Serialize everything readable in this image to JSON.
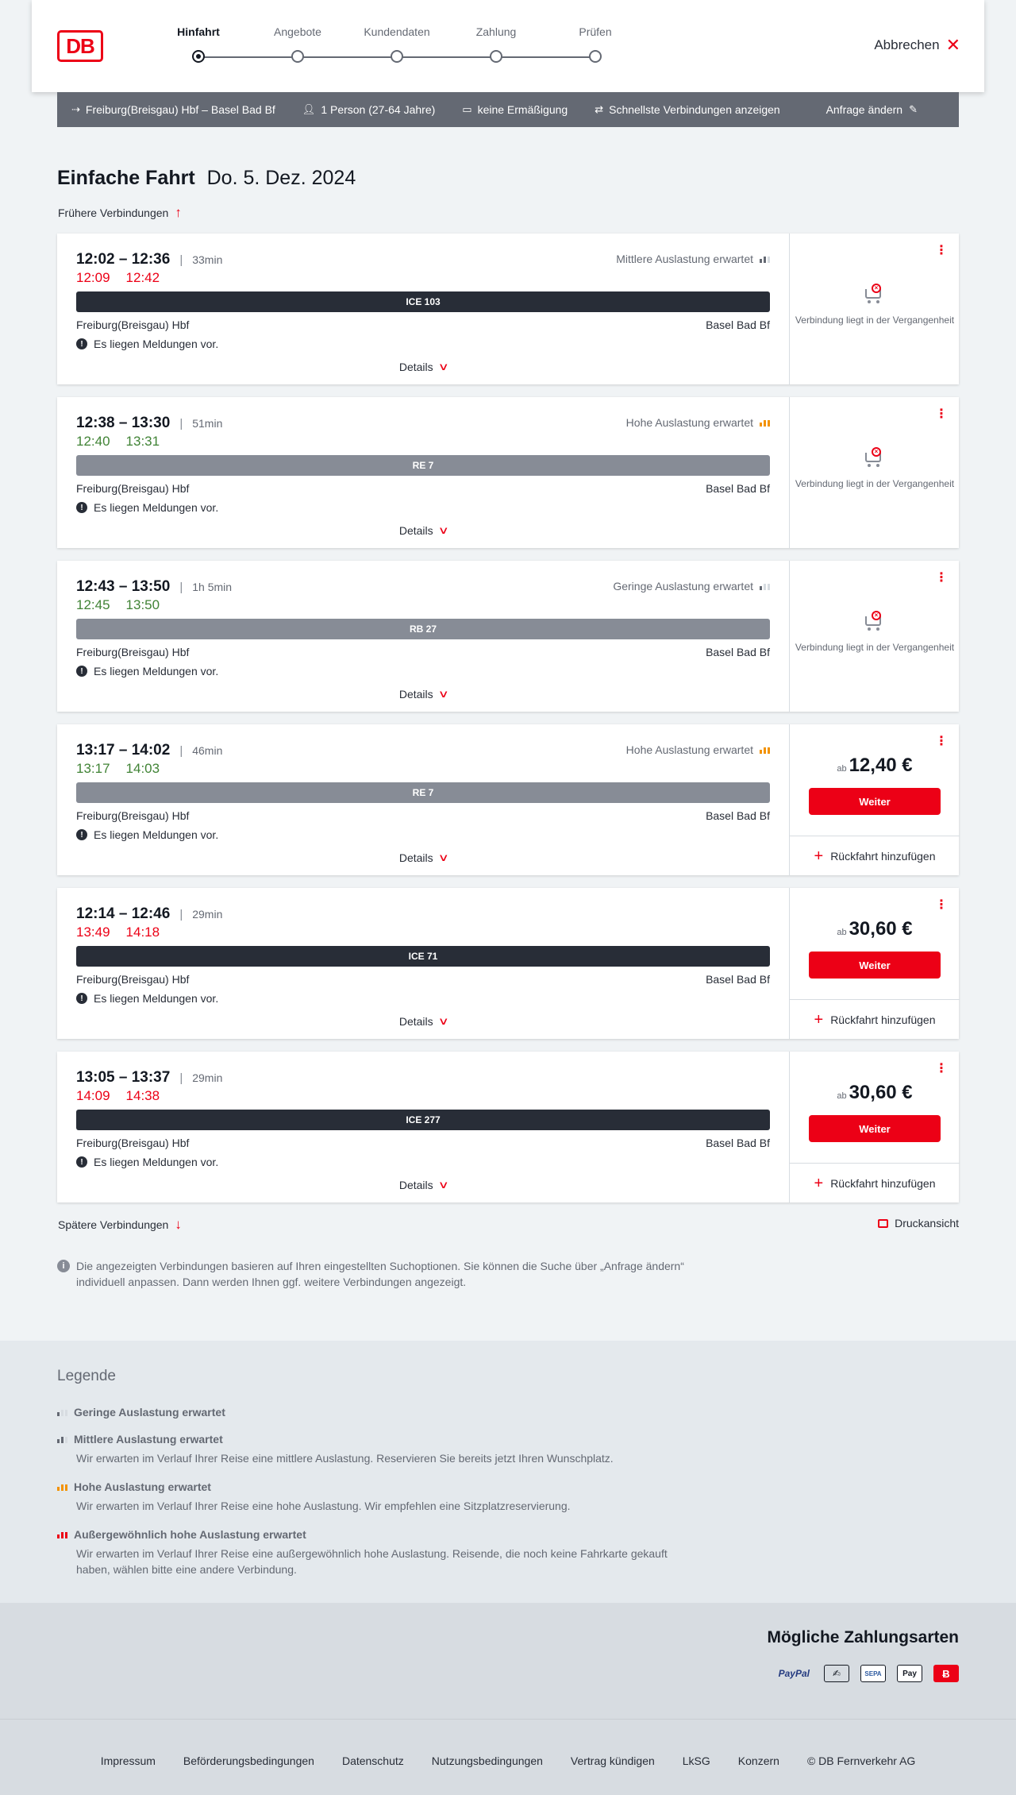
{
  "header": {
    "logo": "DB",
    "steps": [
      {
        "label": "Hinfahrt",
        "active": true
      },
      {
        "label": "Angebote",
        "active": false
      },
      {
        "label": "Kundendaten",
        "active": false
      },
      {
        "label": "Zahlung",
        "active": false
      },
      {
        "label": "Prüfen",
        "active": false
      }
    ],
    "cancel_label": "Abbrechen"
  },
  "searchbar": {
    "route": "Freiburg(Breisgau) Hbf – Basel Bad Bf",
    "passengers": "1 Person (27-64 Jahre)",
    "discount": "keine Ermäßigung",
    "filter": "Schnellste Verbindungen anzeigen",
    "change_label": "Anfrage ändern"
  },
  "title": {
    "type": "Einfache Fahrt",
    "date": "Do. 5. Dez. 2024"
  },
  "earlier_label": "Frühere Verbindungen",
  "later_label": "Spätere Verbindungen",
  "print_label": "Druckansicht",
  "details_label": "Details",
  "past_text": "Verbindung liegt in der Vergangenheit",
  "return_label": "Rückfahrt hinzufügen",
  "weiter_label": "Weiter",
  "price_prefix": "ab",
  "journeys": [
    {
      "time": "12:02 – 12:36",
      "duration": "33min",
      "load": "Mittlere Auslastung erwartet",
      "load_level": 2,
      "rt_dep": "12:09",
      "rt_arr": "12:42",
      "rt_status": "late",
      "train": "ICE 103",
      "train_style": "dark",
      "from": "Freiburg(Breisgau) Hbf",
      "to": "Basel Bad Bf",
      "message": "Es liegen Meldungen vor.",
      "past": true,
      "price": ""
    },
    {
      "time": "12:38 – 13:30",
      "duration": "51min",
      "load": "Hohe Auslastung erwartet",
      "load_level": 3,
      "rt_dep": "12:40",
      "rt_arr": "13:31",
      "rt_status": "ok",
      "train": "RE 7",
      "train_style": "grey",
      "from": "Freiburg(Breisgau) Hbf",
      "to": "Basel Bad Bf",
      "message": "Es liegen Meldungen vor.",
      "past": true,
      "price": ""
    },
    {
      "time": "12:43 – 13:50",
      "duration": "1h 5min",
      "load": "Geringe Auslastung erwartet",
      "load_level": 1,
      "rt_dep": "12:45",
      "rt_arr": "13:50",
      "rt_status": "ok",
      "train": "RB 27",
      "train_style": "grey",
      "from": "Freiburg(Breisgau) Hbf",
      "to": "Basel Bad Bf",
      "message": "Es liegen Meldungen vor.",
      "past": true,
      "price": ""
    },
    {
      "time": "13:17 – 14:02",
      "duration": "46min",
      "load": "Hohe Auslastung erwartet",
      "load_level": 3,
      "rt_dep": "13:17",
      "rt_arr": "14:03",
      "rt_status": "ok",
      "train": "RE 7",
      "train_style": "grey",
      "from": "Freiburg(Breisgau) Hbf",
      "to": "Basel Bad Bf",
      "message": "Es liegen Meldungen vor.",
      "past": false,
      "price": "12,40 €"
    },
    {
      "time": "12:14 – 12:46",
      "duration": "29min",
      "load": "",
      "load_level": 0,
      "rt_dep": "13:49",
      "rt_arr": "14:18",
      "rt_status": "late",
      "train": "ICE 71",
      "train_style": "dark",
      "from": "Freiburg(Breisgau) Hbf",
      "to": "Basel Bad Bf",
      "message": "Es liegen Meldungen vor.",
      "past": false,
      "price": "30,60 €"
    },
    {
      "time": "13:05 – 13:37",
      "duration": "29min",
      "load": "",
      "load_level": 0,
      "rt_dep": "14:09",
      "rt_arr": "14:38",
      "rt_status": "late",
      "train": "ICE 277",
      "train_style": "dark",
      "from": "Freiburg(Breisgau) Hbf",
      "to": "Basel Bad Bf",
      "message": "Es liegen Meldungen vor.",
      "past": false,
      "price": "30,60 €"
    }
  ],
  "info_text": "Die angezeigten Verbindungen basieren auf Ihren eingestellten Suchoptionen. Sie können die Suche über „Anfrage ändern“ individuell anpassen. Dann werden Ihnen ggf. weitere Verbindungen angezeigt.",
  "legend": {
    "title": "Legende",
    "items": [
      {
        "title": "Geringe Auslastung erwartet",
        "desc": "",
        "level": 1
      },
      {
        "title": "Mittlere Auslastung erwartet",
        "desc": "Wir erwarten im Verlauf Ihrer Reise eine mittlere Auslastung. Reservieren Sie bereits jetzt Ihren Wunschplatz.",
        "level": 2
      },
      {
        "title": "Hohe Auslastung erwartet",
        "desc": "Wir erwarten im Verlauf Ihrer Reise eine hohe Auslastung. Wir empfehlen eine Sitzplatzreservierung.",
        "level": 3
      },
      {
        "title": "Außergewöhnlich hohe Auslastung erwartet",
        "desc": "Wir erwarten im Verlauf Ihrer Reise eine außergewöhnlich hohe Auslastung. Reisende, die noch keine Fahrkarte gekauft haben, wählen bitte eine andere Verbindung.",
        "level": 4
      }
    ]
  },
  "payment": {
    "title": "Mögliche Zahlungsarten",
    "methods": [
      {
        "name": "PayPal",
        "icon": "paypal-icon"
      },
      {
        "name": "",
        "icon": "credit-card-icon"
      },
      {
        "name": "SEPA",
        "icon": "sepa-icon"
      },
      {
        "name": "Pay",
        "icon": "apple-pay-icon"
      },
      {
        "name": "",
        "icon": "db-bonus-icon"
      }
    ]
  },
  "footer": {
    "links": [
      "Impressum",
      "Beförderungsbedingungen",
      "Datenschutz",
      "Nutzungsbedingungen",
      "Vertrag kündigen",
      "LkSG",
      "Konzern",
      "© DB Fernverkehr AG"
    ]
  },
  "colors": {
    "accent": "#ec0016",
    "late": "#ec0016",
    "ontime": "#408335",
    "high_load": "#f39200"
  }
}
